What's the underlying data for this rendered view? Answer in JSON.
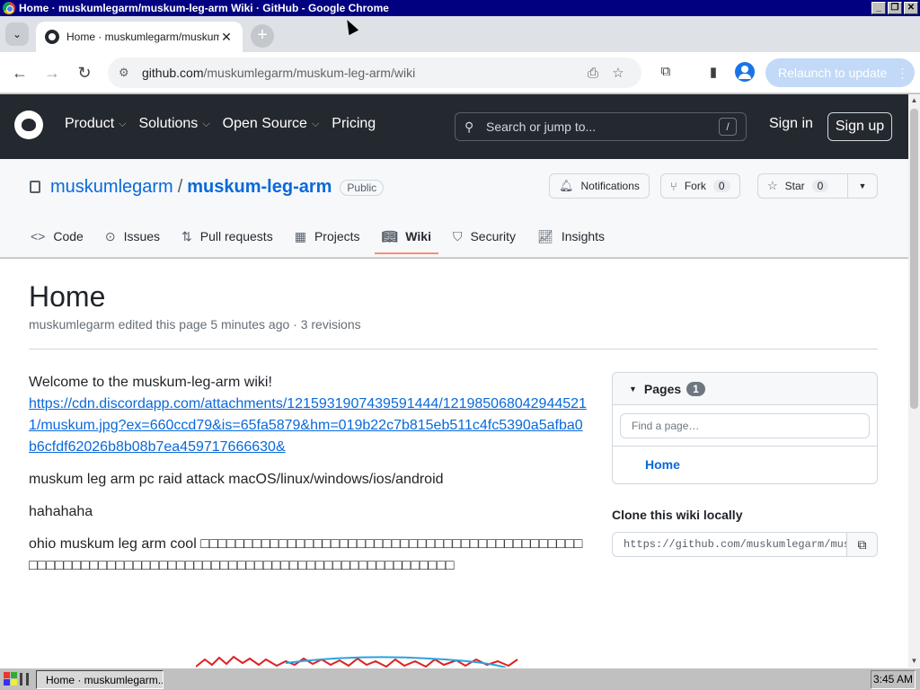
{
  "window": {
    "title": "Home · muskumlegarm/muskum-leg-arm Wiki · GitHub - Google Chrome",
    "controls": [
      "_",
      "❐",
      "✕"
    ]
  },
  "browser": {
    "tab_title": "Home · muskumlegarm/muskum-leg",
    "url_host": "github.com",
    "url_path": "/muskumlegarm/muskum-leg-arm/wiki",
    "relaunch_label": "Relaunch to update"
  },
  "github": {
    "nav": [
      {
        "label": "Product",
        "dropdown": true
      },
      {
        "label": "Solutions",
        "dropdown": true
      },
      {
        "label": "Open Source",
        "dropdown": true
      },
      {
        "label": "Pricing",
        "dropdown": false
      }
    ],
    "search_placeholder": "Search or jump to...",
    "search_shortcut": "/",
    "sign_in": "Sign in",
    "sign_up": "Sign up"
  },
  "repo": {
    "owner": "muskumlegarm",
    "separator": "/",
    "name": "muskum-leg-arm",
    "visibility": "Public",
    "notifications_label": "Notifications",
    "fork_label": "Fork",
    "fork_count": "0",
    "star_label": "Star",
    "star_count": "0",
    "tabs": [
      {
        "label": "Code",
        "icon": "code-icon"
      },
      {
        "label": "Issues",
        "icon": "issue-icon"
      },
      {
        "label": "Pull requests",
        "icon": "pull-request-icon"
      },
      {
        "label": "Projects",
        "icon": "table-icon"
      },
      {
        "label": "Wiki",
        "icon": "book-icon",
        "active": true
      },
      {
        "label": "Security",
        "icon": "shield-icon"
      },
      {
        "label": "Insights",
        "icon": "graph-icon"
      }
    ]
  },
  "wiki": {
    "title": "Home",
    "meta": "muskumlegarm edited this page 5 minutes ago · 3 revisions",
    "welcome": "Welcome to the muskum-leg-arm wiki!",
    "link": "https://cdn.discordapp.com/attachments/1215931907439591444/1219850680429445211/muskum.jpg?ex=660ccd79&is=65fa5879&hm=019b22c7b815eb511c4fc5390a5afba0b6cfdf62026b8b08b7ea459717666630&",
    "paragraph1": "muskum leg arm pc raid attack macOS/linux/windows/ios/android",
    "paragraph2": "hahahaha",
    "paragraph3": "ohio muskum leg arm cool □□□□□□□□□□□□□□□□□□□□□□□□□□□□□□□□□□□□□□□□□□□□□□□□□□□□□□□□□□□□□□□□□□□□□□□□□□□□□□□□□□□□□□□□□□□□□"
  },
  "sidebar": {
    "pages_label": "Pages",
    "pages_count": "1",
    "find_placeholder": "Find a page…",
    "pages": [
      "Home"
    ],
    "clone_title": "Clone this wiki locally",
    "clone_url": "https://github.com/muskumlegarm/muskum-leg-arm.wiki.git"
  },
  "taskbar": {
    "task_label": "Home · muskumlegarm...",
    "clock": "3:45 AM"
  }
}
